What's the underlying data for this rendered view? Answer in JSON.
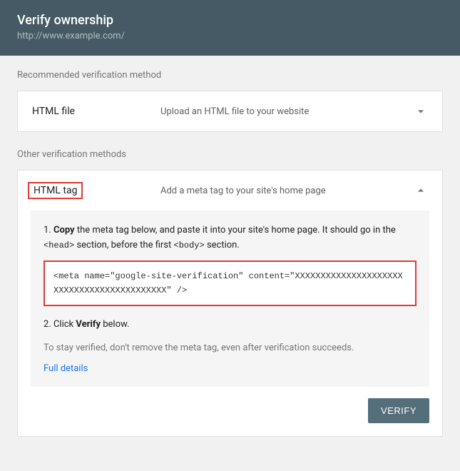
{
  "header": {
    "title": "Verify ownership",
    "subtitle": "http://www.example.com/"
  },
  "sections": {
    "recommended_label": "Recommended verification method",
    "other_label": "Other verification methods"
  },
  "methods": {
    "html_file": {
      "title": "HTML file",
      "desc": "Upload an HTML file to your website"
    },
    "html_tag": {
      "title": "HTML tag",
      "desc": "Add a meta tag to your site's home page"
    }
  },
  "panel": {
    "step1_prefix": "1. ",
    "step1_bold": "Copy",
    "step1_mid": " the meta tag below, and paste it into your site's home page. It should go in the ",
    "step1_code1": "<head>",
    "step1_mid2": " section, before the first ",
    "step1_code2": "<body>",
    "step1_suffix": " section.",
    "meta_code": "<meta name=\"google-site-verification\" content=\"XXXXXXXXXXXXXXXXXXXXXXXXXXXXXXXXXXXXXXXXXXX\" />",
    "step2_prefix": "2. Click ",
    "step2_bold": "Verify",
    "step2_suffix": " below.",
    "note": "To stay verified, don't remove the meta tag, even after verification succeeds.",
    "details_link": "Full details"
  },
  "actions": {
    "verify": "VERIFY"
  }
}
